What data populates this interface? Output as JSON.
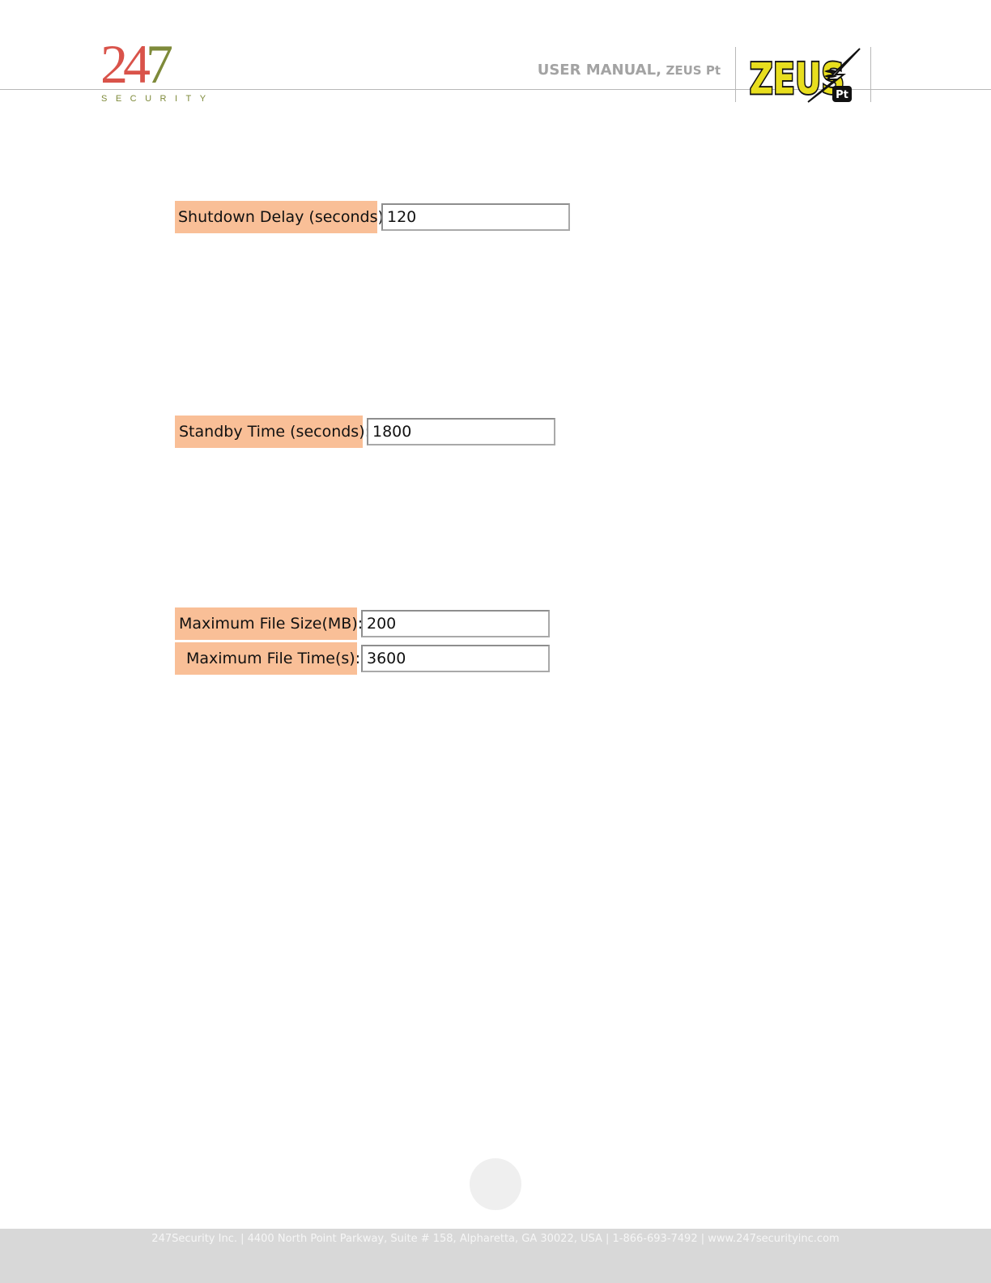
{
  "header": {
    "logo": {
      "digits": [
        "2",
        "4",
        "7"
      ],
      "wordmark": "SECURITY"
    },
    "manual_title": "USER MANUAL,",
    "manual_product": "ZEUS Pt",
    "product_logo": {
      "name": "ZEUS",
      "badge": "Pt",
      "icon": "lightning-bolt-icon"
    }
  },
  "fields": {
    "shutdown_delay": {
      "label": "Shutdown Delay (seconds):",
      "value": "120"
    },
    "standby_time": {
      "label": "Standby Time (seconds):",
      "value": "1800"
    },
    "max_file_size": {
      "label": "Maximum File Size(MB):",
      "value": "200"
    },
    "max_file_time": {
      "label": "Maximum File Time(s):",
      "value": "3600"
    }
  },
  "footer": {
    "text": "247Security Inc. | 4400 North Point Parkway, Suite # 158, Alpharetta, GA  30022,  USA  | 1-866-693-7492   | www.247securityinc.com"
  },
  "colors": {
    "label_bg": "#f9bf97",
    "logo_red": "#d9534a",
    "logo_olive": "#7e8a3a",
    "zeus_yellow": "#e8de1e"
  }
}
